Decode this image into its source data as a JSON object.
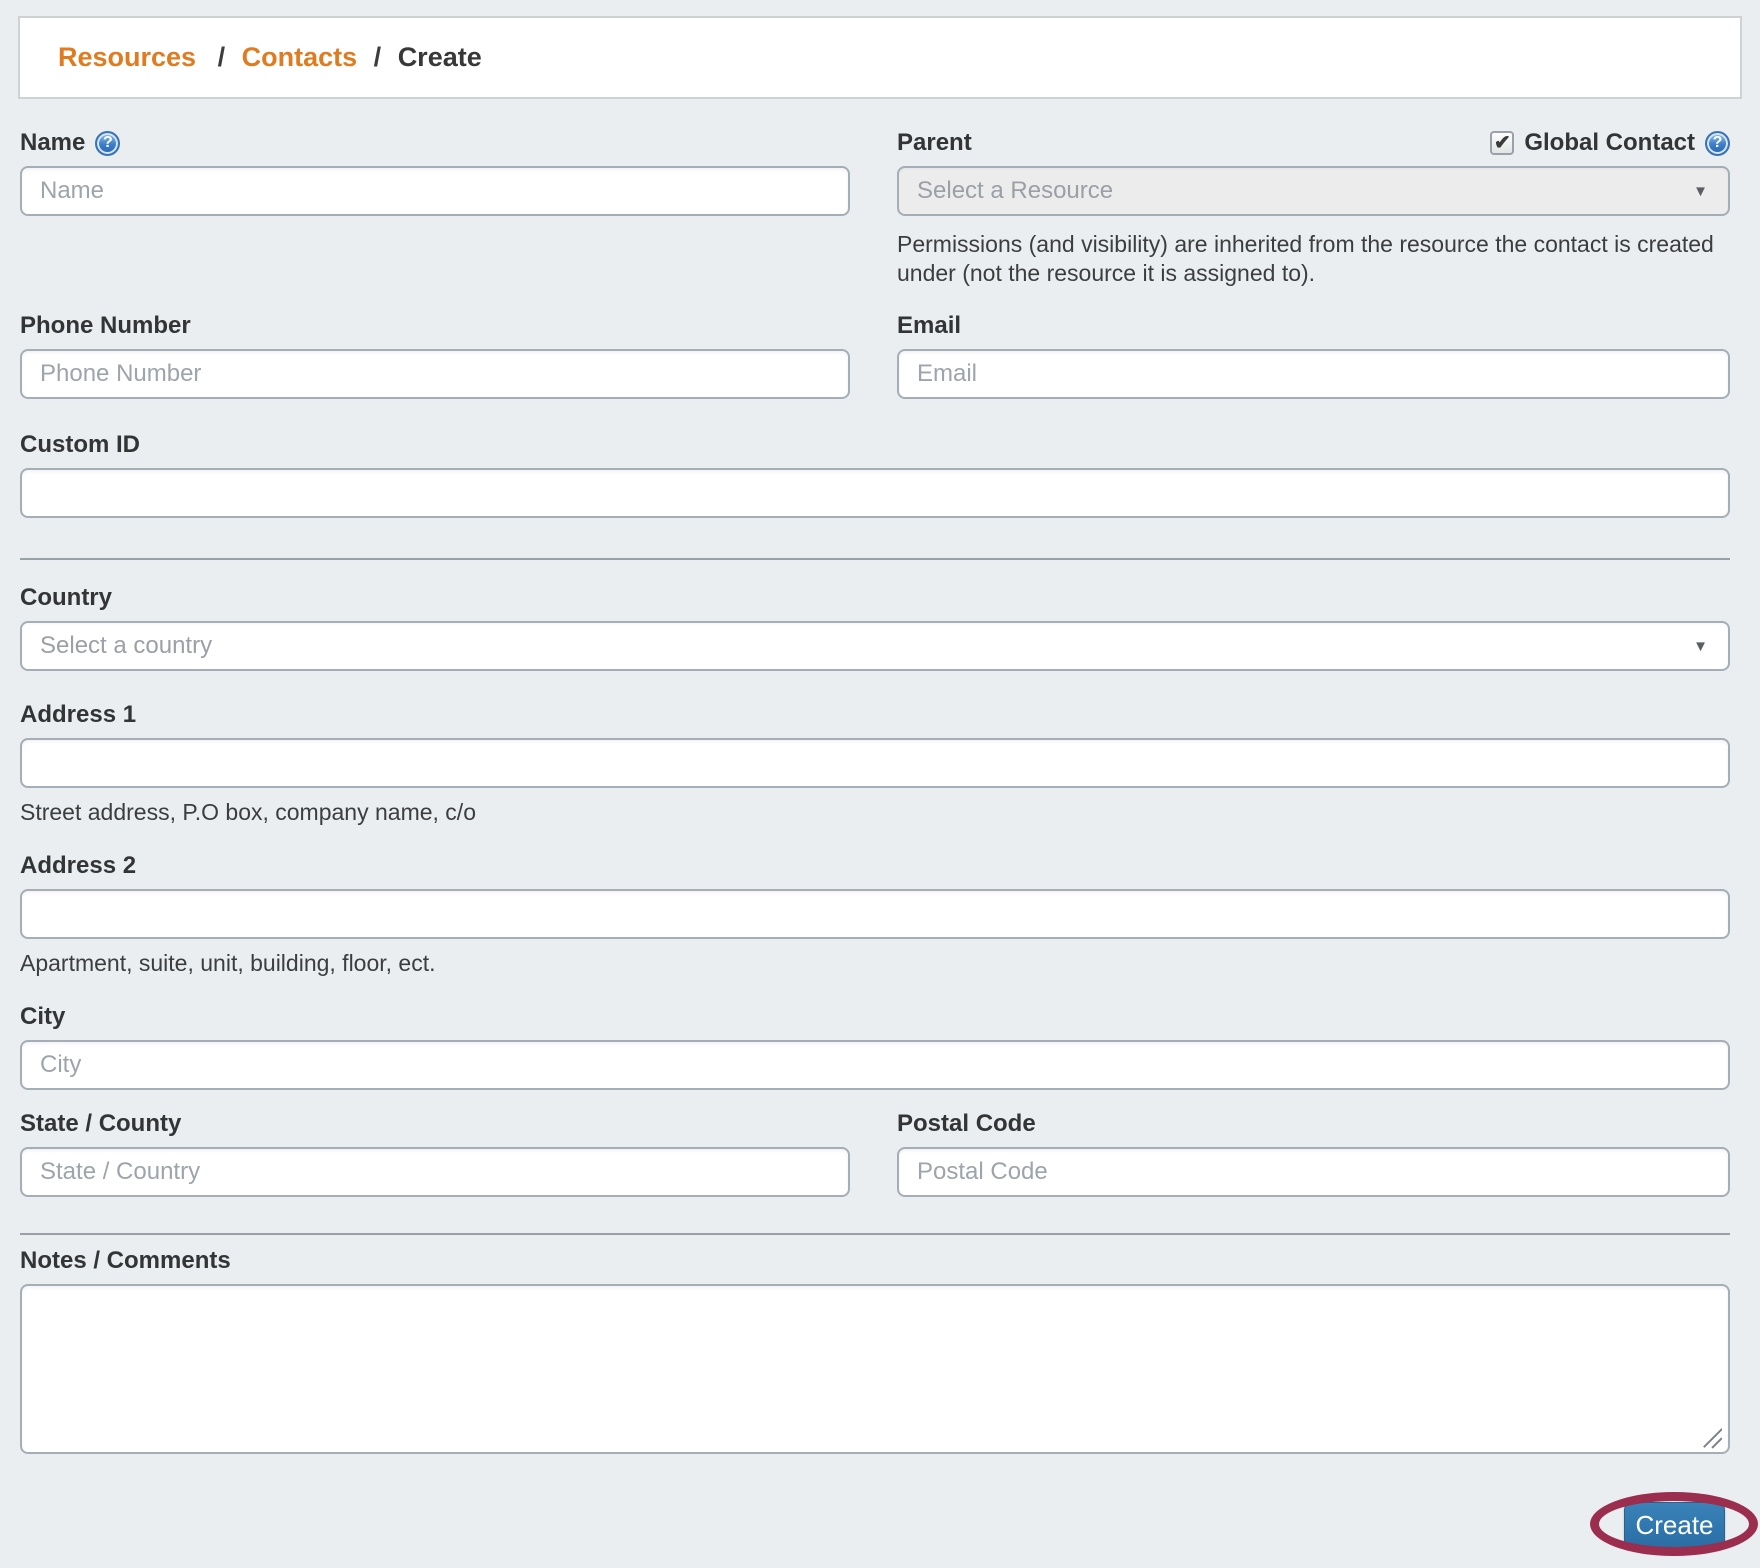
{
  "breadcrumb": {
    "items": [
      {
        "label": "Resources"
      },
      {
        "label": "Contacts"
      },
      {
        "label": "Create"
      }
    ],
    "separator": "/"
  },
  "icons": {
    "help": "?",
    "dropdown_arrow": "▼",
    "check": "✔"
  },
  "colors": {
    "background": "#eaeef1",
    "breadcrumb_link": "#e07b20",
    "button_blue": "#2f76ae",
    "annotation_red": "#9b2d4e",
    "input_border": "#a5adb7"
  },
  "form": {
    "name": {
      "label": "Name",
      "placeholder": "Name",
      "value": ""
    },
    "parent": {
      "label": "Parent",
      "placeholder": "Select a Resource",
      "note": "Permissions (and visibility) are inherited from the resource the contact is created under (not the resource it is assigned to)."
    },
    "global_contact": {
      "label": "Global Contact",
      "checked": true
    },
    "phone": {
      "label": "Phone Number",
      "placeholder": "Phone Number",
      "value": ""
    },
    "email": {
      "label": "Email",
      "placeholder": "Email",
      "value": ""
    },
    "custom_id": {
      "label": "Custom ID",
      "placeholder": "",
      "value": ""
    },
    "country": {
      "label": "Country",
      "placeholder": "Select a country"
    },
    "address1": {
      "label": "Address 1",
      "placeholder": "",
      "value": "",
      "helper": "Street address, P.O box, company name, c/o"
    },
    "address2": {
      "label": "Address 2",
      "placeholder": "",
      "value": "",
      "helper": "Apartment, suite, unit, building, floor, ect."
    },
    "city": {
      "label": "City",
      "placeholder": "City",
      "value": ""
    },
    "state": {
      "label": "State / County",
      "placeholder": "State / Country",
      "value": ""
    },
    "postal": {
      "label": "Postal Code",
      "placeholder": "Postal Code",
      "value": ""
    },
    "notes": {
      "label": "Notes / Comments",
      "value": ""
    },
    "submit": {
      "label": "Create"
    }
  }
}
